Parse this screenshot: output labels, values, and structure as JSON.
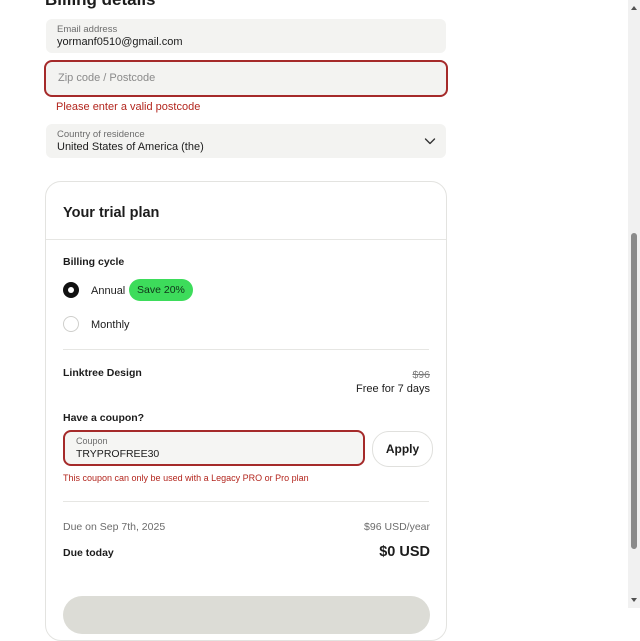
{
  "billing": {
    "title": "Billing details",
    "email_label": "Email address",
    "email_value": "yormanf0510@gmail.com",
    "zip_placeholder": "Zip code / Postcode",
    "zip_error": "Please enter a valid postcode",
    "country_label": "Country of residence",
    "country_value": "United States of America (the)"
  },
  "plan": {
    "title": "Your trial plan",
    "billing_cycle_label": "Billing cycle",
    "annual_label": "Annual",
    "save_badge": "Save 20%",
    "monthly_label": "Monthly",
    "product_name": "Linktree Design",
    "price_original": "$96",
    "price_note": "Free for 7 days",
    "coupon_question": "Have a coupon?",
    "coupon_label": "Coupon",
    "coupon_value": "TRYPROFREE30",
    "apply_label": "Apply",
    "coupon_error": "This coupon can only be used with a Legacy PRO or Pro plan",
    "due_on_label": "Due on Sep 7th, 2025",
    "due_on_value": "$96 USD/year",
    "due_today_label": "Due today",
    "due_today_value": "$0 USD",
    "selected_cycle": "Annual"
  },
  "colors": {
    "error": "#b3261e",
    "badge": "#3ddc5b",
    "field_bg": "#f3f3f1"
  }
}
